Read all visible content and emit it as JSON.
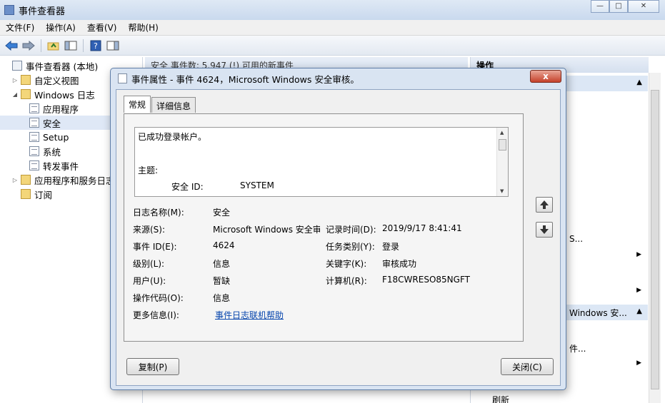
{
  "window": {
    "title": "事件查看器"
  },
  "menu": [
    "文件(F)",
    "操作(A)",
    "查看(V)",
    "帮助(H)"
  ],
  "tree": [
    {
      "label": "事件查看器 (本地)",
      "level": 0,
      "twisty": "",
      "icon": "viewer"
    },
    {
      "label": "自定义视图",
      "level": 1,
      "twisty": "▷",
      "icon": "folder"
    },
    {
      "label": "Windows 日志",
      "level": 1,
      "twisty": "◢",
      "icon": "folder"
    },
    {
      "label": "应用程序",
      "level": 2,
      "twisty": "",
      "icon": "log"
    },
    {
      "label": "安全",
      "level": 2,
      "twisty": "",
      "icon": "log",
      "selected": true
    },
    {
      "label": "Setup",
      "level": 2,
      "twisty": "",
      "icon": "log"
    },
    {
      "label": "系统",
      "level": 2,
      "twisty": "",
      "icon": "log"
    },
    {
      "label": "转发事件",
      "level": 2,
      "twisty": "",
      "icon": "log"
    },
    {
      "label": "应用程序和服务日志",
      "level": 1,
      "twisty": "▷",
      "icon": "folder"
    },
    {
      "label": "订阅",
      "level": 1,
      "twisty": "",
      "icon": "folder"
    }
  ],
  "center": {
    "header": "安全    事件数: 5,947 (!) 可用的新事件"
  },
  "actions": {
    "title": "操作",
    "texts": [
      "S...",
      "Windows 安...",
      "件...",
      "刷新"
    ]
  },
  "dialog": {
    "title": "事件属性 - 事件 4624，Microsoft Windows 安全审核。",
    "close_glyph": "x",
    "tabs": [
      "常规",
      "详细信息"
    ],
    "description": {
      "line1": "已成功登录帐户。",
      "subject_label": "主题:",
      "sid_label": "安全 ID:",
      "sid_value": "SYSTEM"
    },
    "fields": {
      "log_name_label": "日志名称(M):",
      "log_name_value": "安全",
      "source_label": "来源(S):",
      "source_value": "Microsoft Windows 安全审",
      "logged_label": "记录时间(D):",
      "logged_value": "2019/9/17 8:41:41",
      "event_id_label": "事件 ID(E):",
      "event_id_value": "4624",
      "task_label": "任务类别(Y):",
      "task_value": "登录",
      "level_label": "级别(L):",
      "level_value": "信息",
      "keywords_label": "关键字(K):",
      "keywords_value": "审核成功",
      "user_label": "用户(U):",
      "user_value": "暂缺",
      "computer_label": "计算机(R):",
      "computer_value": "F18CWRESO85NGFT",
      "opcode_label": "操作代码(O):",
      "opcode_value": "信息",
      "more_info_label": "更多信息(I):",
      "more_info_link": "事件日志联机帮助"
    },
    "copy_button": "复制(P)",
    "close_button": "关闭(C)"
  },
  "colors": {
    "titlebar": "#c9d9ee",
    "close_red": "#c5412a",
    "link": "#0645ad"
  }
}
